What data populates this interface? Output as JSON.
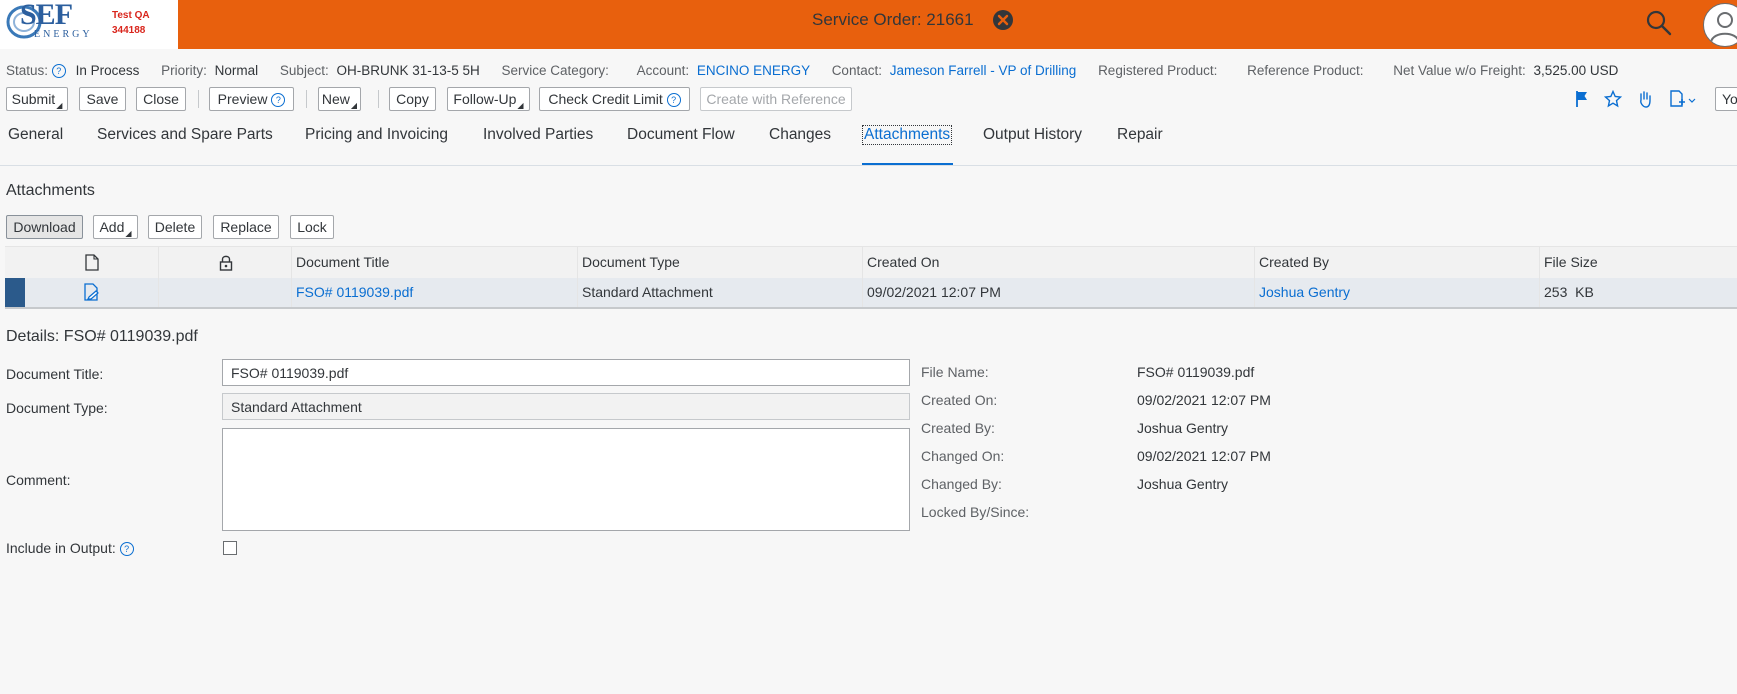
{
  "header": {
    "logo_text": "SEF",
    "logo_sub": "ENERGY",
    "env_line1": "Test QA",
    "env_line2": "344188",
    "title": "Service Order: 21661"
  },
  "status_bar": {
    "status_label": "Status:",
    "status_value": "In Process",
    "priority_label": "Priority:",
    "priority_value": "Normal",
    "subject_label": "Subject:",
    "subject_value": "OH-BRUNK 31-13-5 5H",
    "service_category_label": "Service Category:",
    "account_label": "Account:",
    "account_value": "ENCINO ENERGY",
    "contact_label": "Contact:",
    "contact_value": "Jameson Farrell - VP of Drilling",
    "registered_product_label": "Registered Product:",
    "reference_product_label": "Reference Product:",
    "net_value_label": "Net Value w/o Freight:",
    "net_value": "3,525.00 USD"
  },
  "toolbar": {
    "submit": "Submit",
    "save": "Save",
    "close": "Close",
    "preview": "Preview",
    "new": "New",
    "copy": "Copy",
    "follow_up": "Follow-Up",
    "check_credit_limit": "Check Credit Limit",
    "create_with_reference": "Create with Reference",
    "user_short": "Yo"
  },
  "tabs": [
    "General",
    "Services and Spare Parts",
    "Pricing and Invoicing",
    "Involved Parties",
    "Document Flow",
    "Changes",
    "Attachments",
    "Output History",
    "Repair"
  ],
  "attachments": {
    "title": "Attachments",
    "buttons": {
      "download": "Download",
      "add": "Add",
      "delete": "Delete",
      "replace": "Replace",
      "lock": "Lock"
    },
    "columns": {
      "document_title": "Document Title",
      "document_type": "Document Type",
      "created_on": "Created On",
      "created_by": "Created By",
      "file_size": "File Size"
    },
    "rows": [
      {
        "document_title": "FSO# 0119039.pdf",
        "document_type": "Standard Attachment",
        "created_on": "09/02/2021 12:07 PM",
        "created_by": "Joshua Gentry",
        "file_size": "253  KB"
      }
    ]
  },
  "details": {
    "title": "Details: FSO# 0119039.pdf",
    "document_title_label": "Document Title:",
    "document_title_value": "FSO# 0119039.pdf",
    "document_type_label": "Document Type:",
    "document_type_value": "Standard Attachment",
    "comment_label": "Comment:",
    "comment_value": "",
    "include_in_output_label": "Include in Output:",
    "include_in_output_checked": false,
    "file_name_label": "File Name:",
    "file_name_value": "FSO# 0119039.pdf",
    "created_on_label": "Created On:",
    "created_on_value": "09/02/2021 12:07 PM",
    "created_by_label": "Created By:",
    "created_by_value": "Joshua Gentry",
    "changed_on_label": "Changed On:",
    "changed_on_value": "09/02/2021 12:07 PM",
    "changed_by_label": "Changed By:",
    "changed_by_value": "Joshua Gentry",
    "locked_by_label": "Locked By/Since:",
    "locked_by_value": ""
  },
  "colors": {
    "shell_header": "#e8600d",
    "link": "#0a6ed1",
    "selected_row_marker": "#2b5a8b",
    "env_text": "#d9251c"
  },
  "icons": [
    "logo-swirl",
    "close-circle-icon",
    "search-icon",
    "user-avatar-icon",
    "info-icon",
    "flag-icon",
    "star-icon",
    "hand-icon",
    "add-document-icon",
    "document-icon",
    "lock-icon",
    "document-edit-icon"
  ]
}
